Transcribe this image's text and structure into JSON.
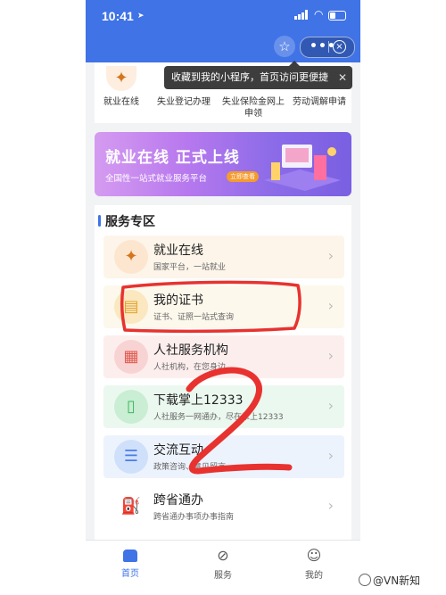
{
  "status_bar": {
    "time": "10:41"
  },
  "shortcuts": [
    {
      "icon": "employment-logo-icon",
      "label": "就业在线"
    },
    {
      "icon": "blank",
      "label": "失业登记办理"
    },
    {
      "icon": "blank",
      "label": "失业保险金网上申领"
    },
    {
      "icon": "blank",
      "label": "劳动调解申请"
    }
  ],
  "tooltip": {
    "text": "收藏到我的小程序，首页访问更便捷"
  },
  "banner": {
    "title": "就业在线  正式上线",
    "subtitle": "全国性一站式就业服务平台",
    "tag": "立即查看"
  },
  "section": {
    "title": "服务专区"
  },
  "services": [
    {
      "title": "就业在线",
      "subtitle": "国家平台，一站就业",
      "bg": "#fdf5ea",
      "circle": "#fde6cf",
      "glyph": "✦",
      "glyph_color": "#d4761e"
    },
    {
      "title": "我的证书",
      "subtitle": "证书、证照一站式查询",
      "bg": "#fdf8ec",
      "circle": "#fbe7c0",
      "glyph": "▤",
      "glyph_color": "#e2a32a"
    },
    {
      "title": "人社服务机构",
      "subtitle": "人社机构，在您身边",
      "bg": "#fdeeee",
      "circle": "#f8d3d3",
      "glyph": "▦",
      "glyph_color": "#e05a4f"
    },
    {
      "title": "下载掌上12333",
      "subtitle": "人社服务一网通办，尽在掌上12333",
      "bg": "#ebf8ef",
      "circle": "#c9eed3",
      "glyph": "▯",
      "glyph_color": "#3fb760"
    },
    {
      "title": "交流互动",
      "subtitle": "政策咨询、意见留言",
      "bg": "#edf3fd",
      "circle": "#cfe0fa",
      "glyph": "☰",
      "glyph_color": "#4a7de6"
    },
    {
      "title": "跨省通办",
      "subtitle": "跨省通办事项办事指南",
      "bg": "#ffffff",
      "circle": "#ffffff",
      "glyph": "⛽",
      "glyph_color": "#3f73e6"
    }
  ],
  "tabs": [
    {
      "label": "首页",
      "icon": "home-icon",
      "active": true
    },
    {
      "label": "服务",
      "icon": "compass-icon",
      "active": false
    },
    {
      "label": "我的",
      "icon": "profile-icon",
      "active": false
    }
  ],
  "watermark": {
    "text": "@VN新知"
  },
  "annotation": {
    "number": "2",
    "color": "#e8322f"
  }
}
